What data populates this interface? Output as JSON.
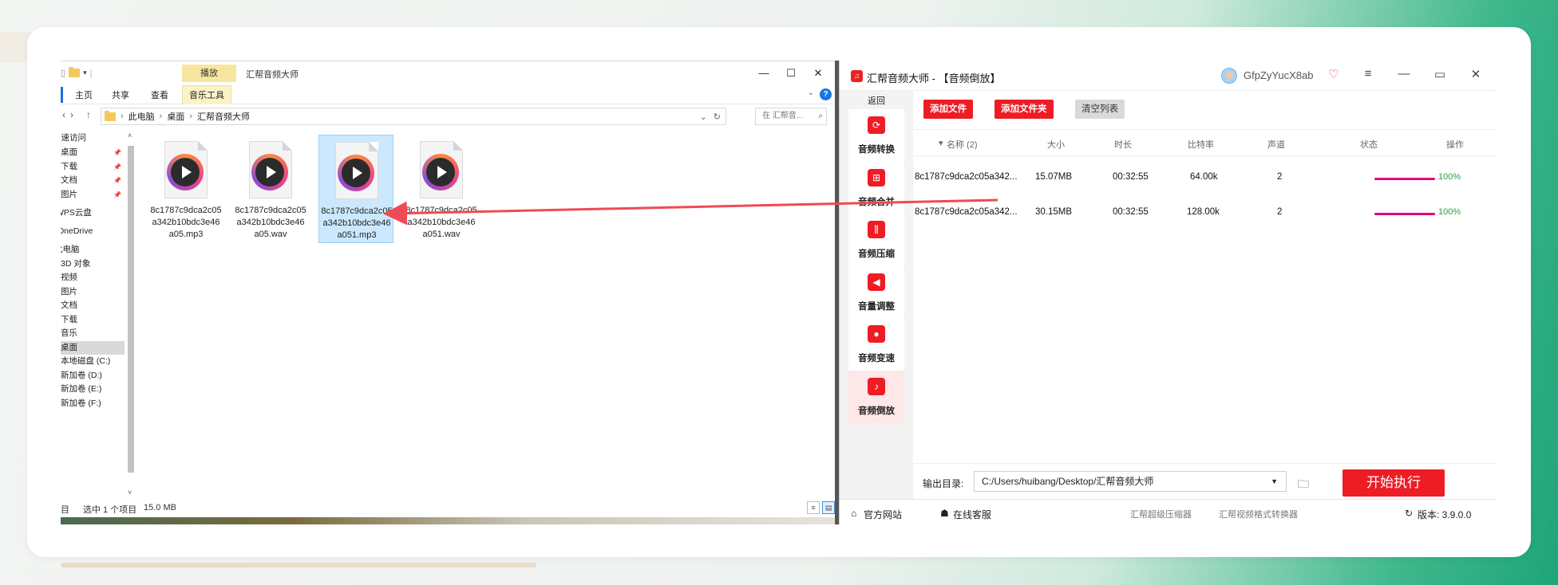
{
  "explorer": {
    "context_tab": "播放",
    "window_title": "汇帮音频大师",
    "ribbon_tabs": [
      "主页",
      "共享",
      "查看",
      "音乐工具"
    ],
    "breadcrumb": [
      "此电脑",
      "桌面",
      "汇帮音频大师"
    ],
    "search_placeholder": "在 汇帮音...",
    "nav_items": [
      {
        "label": "快速访问"
      },
      {
        "label": "桌面"
      },
      {
        "label": "下载"
      },
      {
        "label": "文档"
      },
      {
        "label": "图片"
      },
      {
        "label": "WPS云盘"
      },
      {
        "label": "OneDrive"
      },
      {
        "label": "此电脑"
      },
      {
        "label": "3D 对象"
      },
      {
        "label": "视频"
      },
      {
        "label": "图片"
      },
      {
        "label": "文档"
      },
      {
        "label": "下载"
      },
      {
        "label": "音乐"
      },
      {
        "label": "桌面"
      },
      {
        "label": "本地磁盘 (C:)"
      },
      {
        "label": "新加卷 (D:)"
      },
      {
        "label": "新加卷 (E:)"
      },
      {
        "label": "新加卷 (F:)"
      }
    ],
    "files": [
      {
        "name": "8c1787c9dca2c05a342b10bdc3e46a05.mp3"
      },
      {
        "name": "8c1787c9dca2c05a342b10bdc3e46a05.wav"
      },
      {
        "name": "8c1787c9dca2c05a342b10bdc3e46a051.mp3"
      },
      {
        "name": "8c1787c9dca2c05a342b10bdc3e46a051.wav"
      }
    ],
    "status": {
      "items_suffix": "目",
      "selected": "选中 1 个项目",
      "size": "15.0 MB"
    }
  },
  "app": {
    "title": "汇帮音频大师 - 【音频倒放】",
    "username": "GfpZyYucX8ab",
    "back": "返回",
    "sidebar": [
      {
        "label": "音频转换",
        "icon": "audio-convert-icon"
      },
      {
        "label": "音频合并",
        "icon": "audio-merge-icon"
      },
      {
        "label": "音频压缩",
        "icon": "audio-compress-icon"
      },
      {
        "label": "音量调整",
        "icon": "volume-icon"
      },
      {
        "label": "音频变速",
        "icon": "speed-icon"
      },
      {
        "label": "音频倒放",
        "icon": "reverse-icon"
      }
    ],
    "toolbar": {
      "add_file": "添加文件",
      "add_folder": "添加文件夹",
      "clear_list": "清空列表"
    },
    "columns": {
      "name": "名称 (2)",
      "size": "大小",
      "duration": "时长",
      "bitrate": "比特率",
      "channels": "声道",
      "status": "状态",
      "ops": "操作"
    },
    "rows": [
      {
        "name": "8c1787c9dca2c05a342...",
        "size": "15.07MB",
        "duration": "00:32:55",
        "bitrate": "64.00k",
        "channels": "2",
        "progress": "100%"
      },
      {
        "name": "8c1787c9dca2c05a342...",
        "size": "30.15MB",
        "duration": "00:32:55",
        "bitrate": "128.00k",
        "channels": "2",
        "progress": "100%"
      }
    ],
    "output_label": "输出目录:",
    "output_path": "C:/Users/huibang/Desktop/汇帮音频大师",
    "start": "开始执行",
    "footer": {
      "site": "官方网站",
      "service": "在线客服",
      "compressor": "汇帮超级压缩器",
      "converter": "汇帮视频格式转换器",
      "version": "版本: 3.9.0.0"
    }
  }
}
